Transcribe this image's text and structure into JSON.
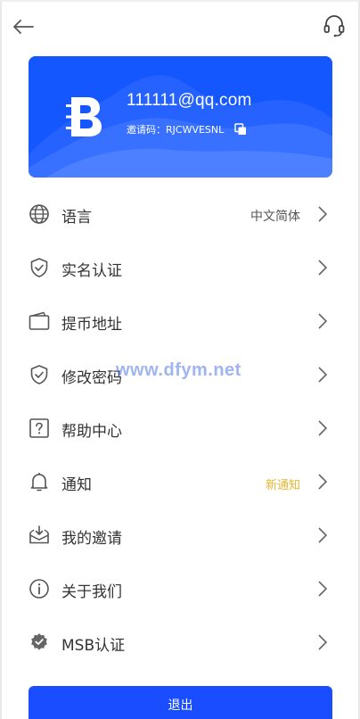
{
  "header": {
    "back_icon": "arrow-left-icon",
    "support_icon": "headset-icon"
  },
  "profile": {
    "email": "111111@qq.com",
    "invite_label": "邀请码：",
    "invite_code": "RJCWVESNL",
    "logo_icon": "brand-b-logo",
    "copy_icon": "copy-icon",
    "card_color": "#1557ff"
  },
  "menu": {
    "items": [
      {
        "label": "语言",
        "value": "中文简体",
        "icon": "globe-icon"
      },
      {
        "label": "实名认证",
        "value": "",
        "icon": "shield-check-icon"
      },
      {
        "label": "提币地址",
        "value": "",
        "icon": "wallet-icon"
      },
      {
        "label": "修改密码",
        "value": "",
        "icon": "shield-check-icon"
      },
      {
        "label": "帮助中心",
        "value": "",
        "icon": "question-icon"
      },
      {
        "label": "通知",
        "value": "新通知",
        "icon": "bell-icon"
      },
      {
        "label": "我的邀请",
        "value": "",
        "icon": "invite-inbox-icon"
      },
      {
        "label": "关于我们",
        "value": "",
        "icon": "info-icon"
      },
      {
        "label": "MSB认证",
        "value": "",
        "icon": "verified-badge-icon"
      }
    ]
  },
  "watermark": "www.dfym.net",
  "logout": {
    "label": "退出",
    "color": "#1a4dff"
  }
}
